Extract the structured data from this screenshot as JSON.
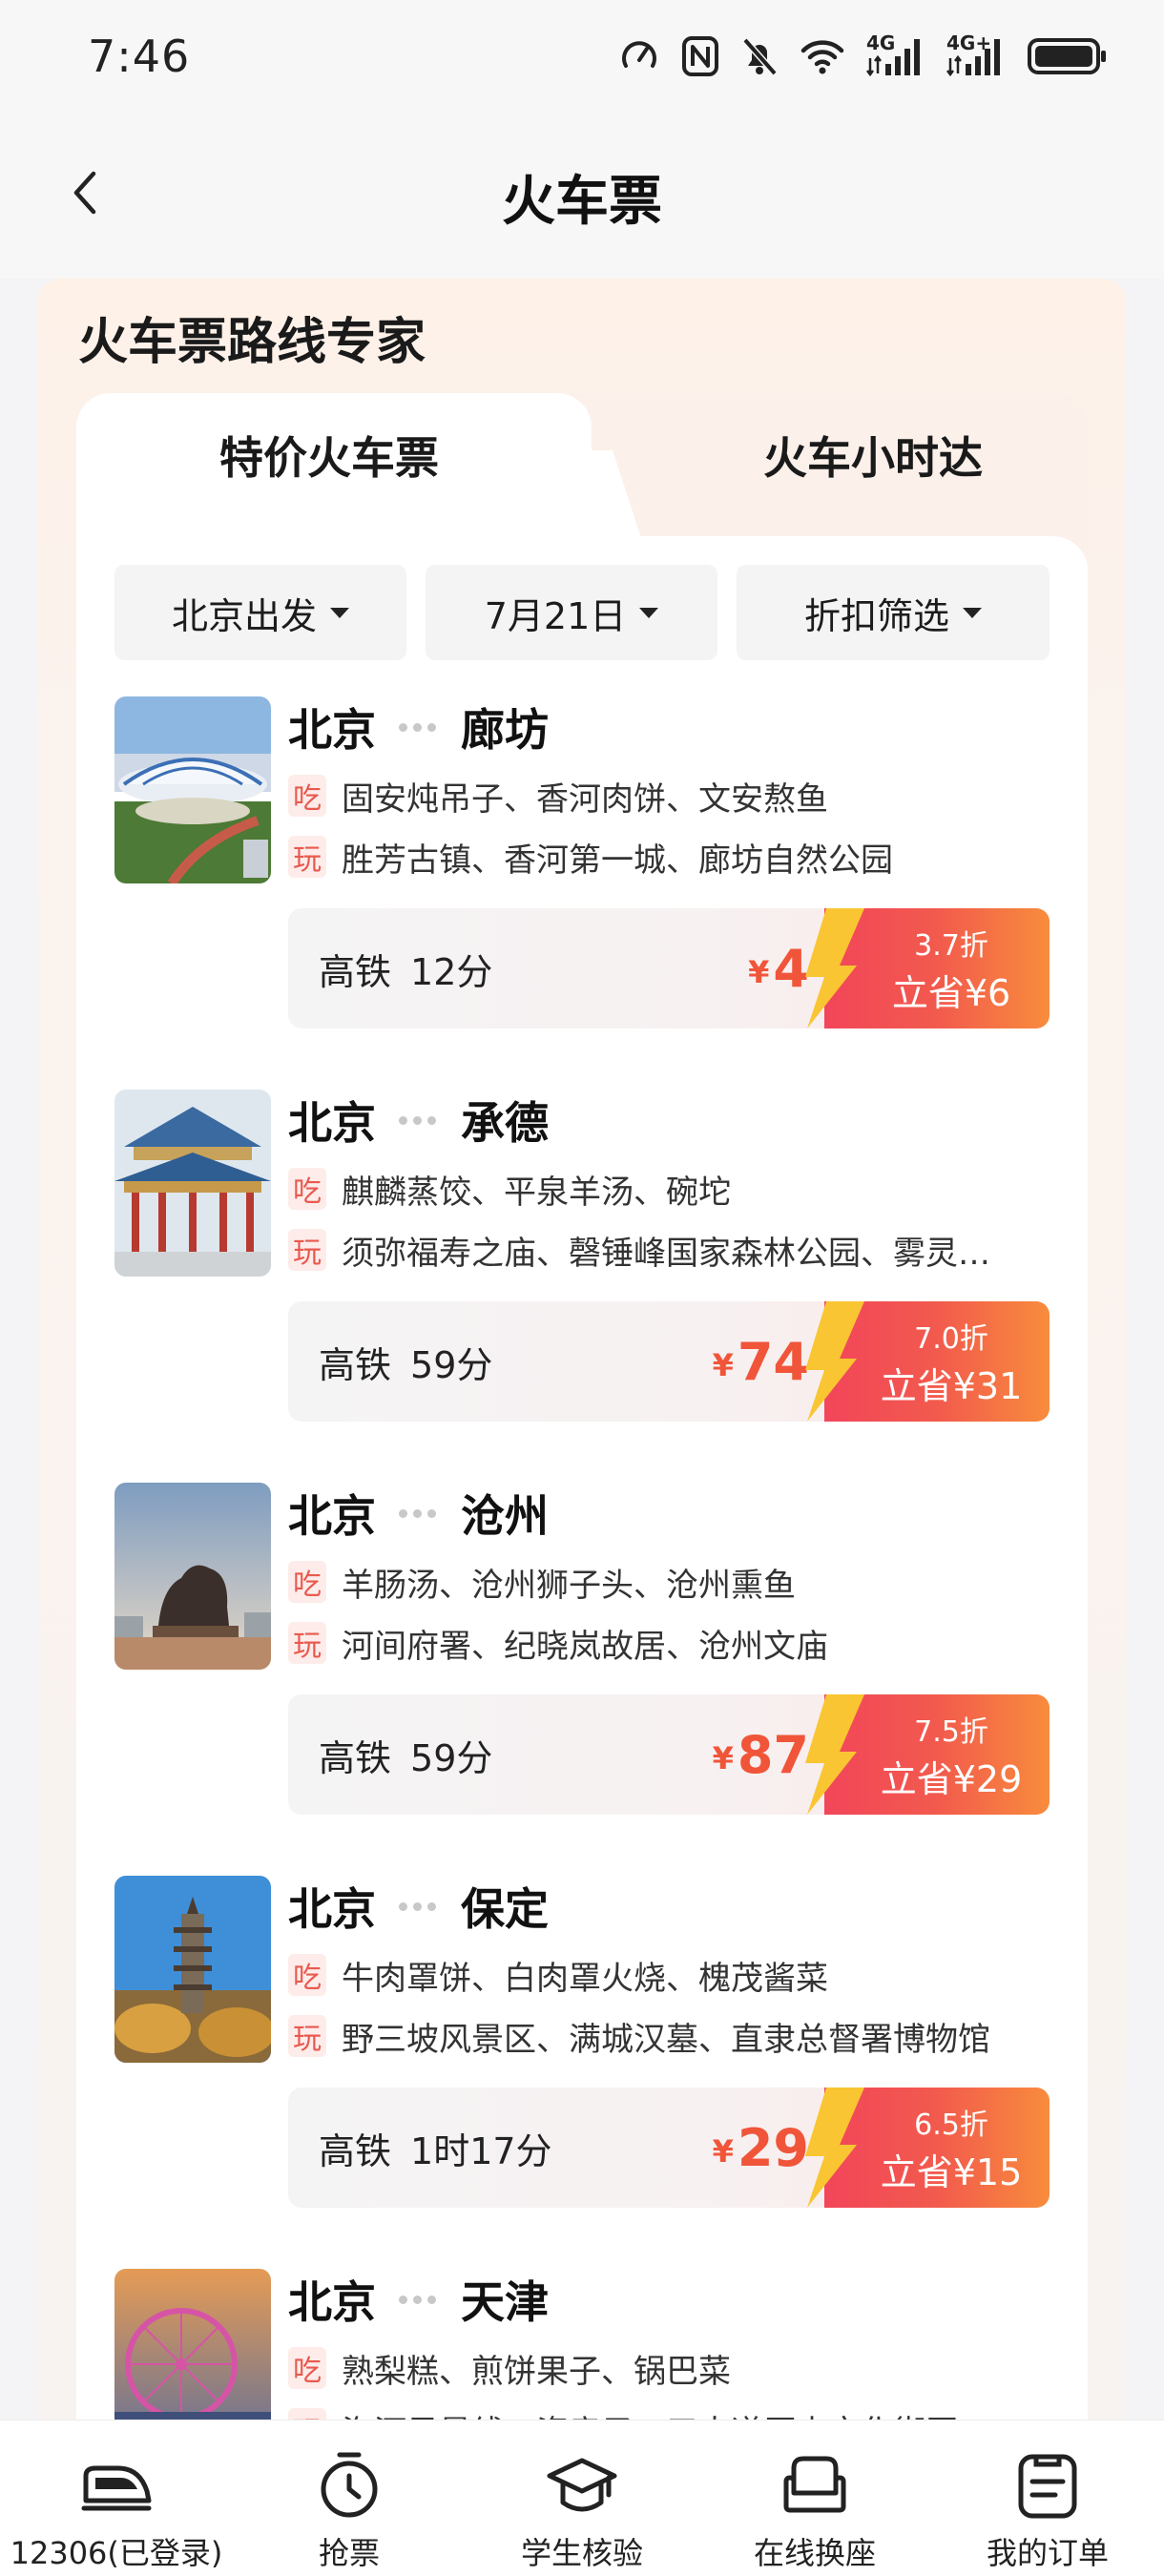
{
  "status_bar": {
    "time": "7:46",
    "network_labels": [
      "4G",
      "4G+"
    ],
    "icons": [
      "speed-icon",
      "nfc-icon",
      "mute-icon",
      "wifi-icon",
      "signal-icon",
      "signal-icon",
      "battery-icon"
    ]
  },
  "header": {
    "title": "火车票",
    "back_icon": "chevron-left-icon"
  },
  "section": {
    "title": "火车票路线专家",
    "tabs": [
      {
        "label": "特价火车票",
        "active": true
      },
      {
        "label": "火车小时达",
        "active": false
      }
    ],
    "filters": [
      {
        "label": "北京出发"
      },
      {
        "label": "7月21日"
      },
      {
        "label": "折扣筛选"
      }
    ]
  },
  "routes": [
    {
      "from": "北京",
      "to": "廊坊",
      "eat_tag": "吃",
      "eat": "固安炖吊子、香河肉饼、文安熬鱼",
      "play_tag": "玩",
      "play": "胜芳古镇、香河第一城、廊坊自然公园",
      "train_type": "高铁",
      "duration": "12分",
      "currency": "¥",
      "price": "4",
      "discount": "3.7折",
      "save": "立省¥6"
    },
    {
      "from": "北京",
      "to": "承德",
      "eat_tag": "吃",
      "eat": "麒麟蒸饺、平泉羊汤、碗坨",
      "play_tag": "玩",
      "play": "须弥福寿之庙、磬锤峰国家森林公园、雾灵…",
      "train_type": "高铁",
      "duration": "59分",
      "currency": "¥",
      "price": "74",
      "discount": "7.0折",
      "save": "立省¥31"
    },
    {
      "from": "北京",
      "to": "沧州",
      "eat_tag": "吃",
      "eat": "羊肠汤、沧州狮子头、沧州熏鱼",
      "play_tag": "玩",
      "play": "河间府署、纪晓岚故居、沧州文庙",
      "train_type": "高铁",
      "duration": "59分",
      "currency": "¥",
      "price": "87",
      "discount": "7.5折",
      "save": "立省¥29"
    },
    {
      "from": "北京",
      "to": "保定",
      "eat_tag": "吃",
      "eat": "牛肉罩饼、白肉罩火烧、槐茂酱菜",
      "play_tag": "玩",
      "play": "野三坡风景区、满城汉墓、直隶总督署博物馆",
      "train_type": "高铁",
      "duration": "1时17分",
      "currency": "¥",
      "price": "29",
      "discount": "6.5折",
      "save": "立省¥15"
    },
    {
      "from": "北京",
      "to": "天津",
      "eat_tag": "吃",
      "eat": "熟梨糕、煎饼果子、锅巴菜",
      "play_tag": "玩",
      "play": "海河风景线、瓷房子、五大道历史文化街区"
    }
  ],
  "bottom_nav": [
    {
      "label": "12306(已登录)",
      "icon": "train-icon"
    },
    {
      "label": "抢票",
      "icon": "stopwatch-icon"
    },
    {
      "label": "学生核验",
      "icon": "graduation-cap-icon"
    },
    {
      "label": "在线换座",
      "icon": "seat-icon"
    },
    {
      "label": "我的订单",
      "icon": "order-list-icon"
    }
  ],
  "colors": {
    "accent": "#f0553a",
    "discount_gradient_start": "#f2455a",
    "discount_gradient_end": "#f88c3c",
    "tag_text": "#e85a4f",
    "bolt": "#f9c532"
  }
}
